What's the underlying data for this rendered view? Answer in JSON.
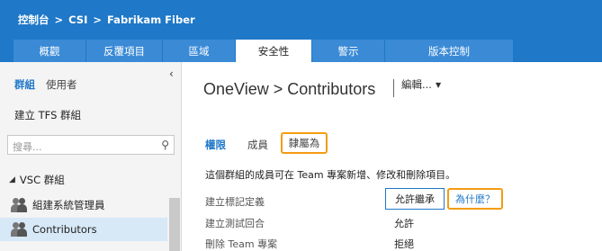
{
  "breadcrumb": [
    "控制台",
    "CSI",
    "Fabrikam Fiber"
  ],
  "breadcrumb_sep": ">",
  "tabs": [
    {
      "label": "概觀"
    },
    {
      "label": "反覆項目"
    },
    {
      "label": "區域"
    },
    {
      "label": "安全性",
      "active": true
    },
    {
      "label": "警示"
    },
    {
      "label": "版本控制"
    }
  ],
  "sidebar": {
    "collapse_glyph": "‹",
    "tab_groups": "群組",
    "tab_users": "使用者",
    "create_group": "建立 TFS 群組",
    "search_placeholder": "搜尋...",
    "search_icon": "search-icon",
    "tree_header": "VSC 群組",
    "items": [
      {
        "label": "組建系統管理員"
      },
      {
        "label": "Contributors",
        "selected": true
      }
    ]
  },
  "main": {
    "title": "OneView > Contributors",
    "edit_label": "編輯...",
    "tabs": {
      "permissions": "權限",
      "members": "成員",
      "member_of": "隸屬為"
    },
    "description": "這個群組的成員可在 Team 專案新增、修改和刪除項目。",
    "permissions": [
      {
        "name": "建立標記定義",
        "value": "允許繼承"
      },
      {
        "name": "建立測試回合",
        "value": "允許"
      },
      {
        "name": "刪除 Team 專案",
        "value": "拒絕"
      }
    ],
    "why_link": "為什麼？"
  },
  "colors": {
    "header": "#1f78c8",
    "tab_inactive": "#3a8ad6",
    "highlight": "#f39c12",
    "selected_row": "#d7e8f7"
  }
}
